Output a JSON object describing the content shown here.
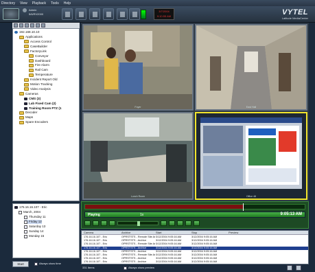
{
  "menu": [
    "Directory",
    "View",
    "Playback",
    "Tools",
    "Help"
  ],
  "toolbar": {
    "user_name": "Admin",
    "user_date": "5/6/RV2000",
    "time_line1": "3/7/2004",
    "time_line2": "9:10:55 AM",
    "brand_name": "VYTEL",
    "brand_sub": "Latitude MediaCenter"
  },
  "tree": {
    "root": "192.168.10.10",
    "items": [
      {
        "label": "Applications",
        "depth": 1,
        "kind": "folder",
        "bold": false
      },
      {
        "label": "Access Control",
        "depth": 2,
        "kind": "folder",
        "bold": false
      },
      {
        "label": "CaseBuilder",
        "depth": 2,
        "kind": "folder",
        "bold": false
      },
      {
        "label": "FactoryLink",
        "depth": 2,
        "kind": "folder",
        "bold": false
      },
      {
        "label": "Conveyor",
        "depth": 3,
        "kind": "folder",
        "bold": false
      },
      {
        "label": "Dashboard",
        "depth": 3,
        "kind": "folder",
        "bold": false
      },
      {
        "label": "Fire Alarm",
        "depth": 3,
        "kind": "folder",
        "bold": false
      },
      {
        "label": "Rail Cam",
        "depth": 3,
        "kind": "folder",
        "bold": false
      },
      {
        "label": "Temperature",
        "depth": 3,
        "kind": "folder",
        "bold": false
      },
      {
        "label": "Incident Report Old",
        "depth": 2,
        "kind": "folder",
        "bold": false
      },
      {
        "label": "Motion Tracking",
        "depth": 2,
        "kind": "folder",
        "bold": false
      },
      {
        "label": "Video Analysis",
        "depth": 2,
        "kind": "folder",
        "bold": false
      },
      {
        "label": "Cameras",
        "depth": 1,
        "kind": "folder",
        "bold": false
      },
      {
        "label": "CMS (3)",
        "depth": 2,
        "kind": "camera",
        "bold": true
      },
      {
        "label": "Lab Fixed Cam (2)",
        "depth": 2,
        "kind": "camera",
        "bold": true
      },
      {
        "label": "Training Room PTZ (1",
        "depth": 2,
        "kind": "camera",
        "bold": true
      },
      {
        "label": "Decoder",
        "depth": 1,
        "kind": "folder",
        "bold": false
      },
      {
        "label": "Maps",
        "depth": 1,
        "kind": "folder",
        "bold": false
      },
      {
        "label": "Spare Encoders",
        "depth": 1,
        "kind": "folder",
        "bold": false
      }
    ]
  },
  "schedule": {
    "server": "176.16.16.107 - Eric",
    "month": "March, 2004",
    "days": [
      "Thursday 11",
      "Friday 12",
      "Saturday 13",
      "Sunday 14",
      "Monday 15"
    ],
    "selected_index": 1
  },
  "left_bottom": {
    "start_label": "Start",
    "always_show_time": "Always show time"
  },
  "video": {
    "panes": [
      {
        "label": "Foyer"
      },
      {
        "label": "East Hall"
      },
      {
        "label": "Lunch Room"
      },
      {
        "label": "Office 48"
      }
    ],
    "active_index": 3
  },
  "playback": {
    "state": "Playing",
    "speed": "1x",
    "clock": "9:05:13 AM",
    "progress": 0.72
  },
  "results": {
    "columns": [
      "Camera",
      "Archive",
      "Start",
      "Stop",
      "Preview"
    ],
    "rows": [
      [
        "176.16.16.107 - Eric",
        "OPRSTSTS - Remote Site Ar",
        "3/12/2004 9:05:16 AM",
        "3/12/2004 9:05:16 AM"
      ],
      [
        "176.16.16.107 - Eric",
        "OPRSTSTS - Archive",
        "3/12/2004 9:05:16 AM",
        "3/12/2004 9:05:16 AM"
      ],
      [
        "176.16.16.107 - Eric",
        "OPRSTSTS - Remote Site Ar",
        "3/12/2004 9:05:16 AM",
        "3/12/2004 9:05:16 AM"
      ],
      [
        "176.16.16.107 - Eric",
        "OPRSTSTS - Archive",
        "3/12/2004 9:05:16 AM",
        "3/12/2004 9:05:16 AM"
      ],
      [
        "176.16.16.107 - Eric",
        "OPRSTSTS - Archive",
        "3/12/2004 9:05:16 AM",
        "3/12/2004 9:05:16 AM"
      ],
      [
        "176.16.16.107 - Eric",
        "OPRSTSTS - Remote Site Ar",
        "3/12/2004 9:05:16 AM",
        "3/12/2004 9:05:16 AM"
      ],
      [
        "176.16.16.107 - Eric",
        "OPRSTSTS - Archive",
        "3/12/2004 9:05:16 AM",
        "3/12/2004 9:05:16 AM"
      ],
      [
        "176.16.16.107 - Eric",
        "OPRSTSTS - Archive",
        "3/12/2004 9:05:16 AM",
        "3/12/2004 9:05:16 AM"
      ]
    ],
    "selected_index": 3
  },
  "status": {
    "count": "331 Items",
    "always_show_preview": "Always show preview"
  },
  "colors": {
    "active_pane": "#f2e52c",
    "playbar_green": "#3aa03a",
    "selected_row": "#1f3f8f"
  }
}
